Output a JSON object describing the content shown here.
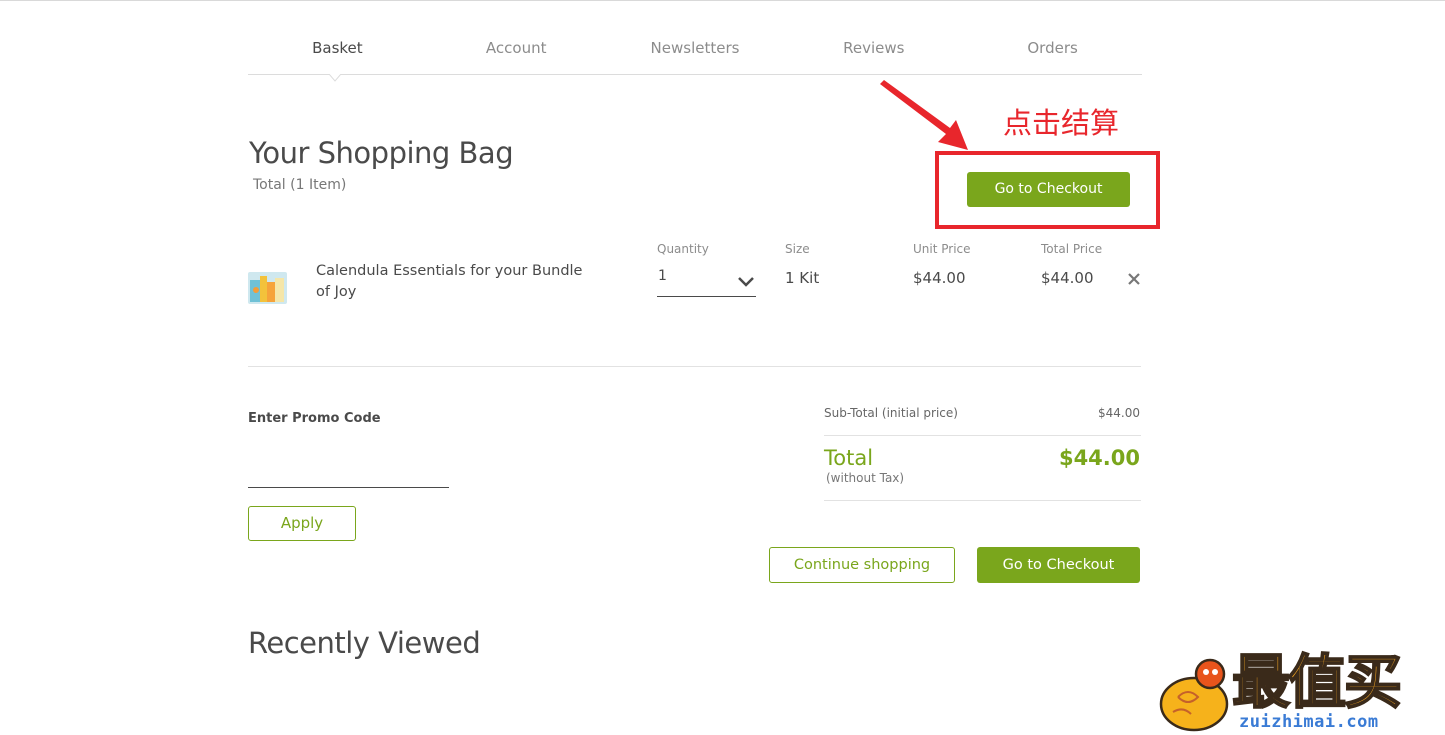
{
  "tabs": [
    {
      "label": "Basket",
      "active": true
    },
    {
      "label": "Account",
      "active": false
    },
    {
      "label": "Newsletters",
      "active": false
    },
    {
      "label": "Reviews",
      "active": false
    },
    {
      "label": "Orders",
      "active": false
    }
  ],
  "page": {
    "title": "Your Shopping Bag",
    "subtitle": "Total (1 Item)"
  },
  "annotation": {
    "text": "点击结算",
    "color": "#e8262c"
  },
  "buttons": {
    "checkout_top": "Go to Checkout",
    "checkout_bottom": "Go to Checkout",
    "continue": "Continue shopping",
    "apply": "Apply"
  },
  "item": {
    "name": "Calendula Essentials for your Bundle of Joy",
    "quantity_label": "Quantity",
    "quantity_value": "1",
    "size_label": "Size",
    "size_value": "1 Kit",
    "unit_price_label": "Unit Price",
    "unit_price_value": "$44.00",
    "total_price_label": "Total Price",
    "total_price_value": "$44.00",
    "remove_icon": "close-icon"
  },
  "promo": {
    "label": "Enter Promo Code",
    "value": ""
  },
  "summary": {
    "subtotal_label": "Sub-Total (initial price)",
    "subtotal_value": "$44.00",
    "total_label": "Total",
    "total_note": "(without Tax)",
    "total_value": "$44.00"
  },
  "recent": {
    "title": "Recently Viewed"
  },
  "watermark": {
    "chinese": "最值买",
    "url": "zuizhimai.com"
  },
  "colors": {
    "accent": "#7aa61c",
    "annotation": "#e8262c",
    "text": "#4a4a4a"
  }
}
